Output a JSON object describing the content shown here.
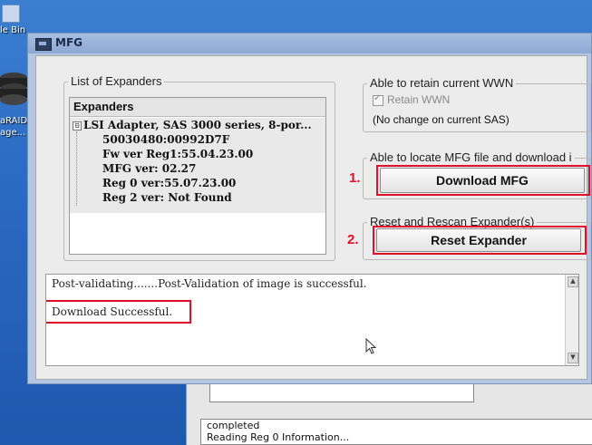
{
  "desktop": {
    "recycle_bin_label": "le Bin",
    "raid_label_line1": "aRAID",
    "raid_label_line2": "age..."
  },
  "window": {
    "title": "MFG"
  },
  "expanders_group": {
    "legend": "List of Expanders",
    "column_header": "Expanders",
    "root_item": "LSI Adapter, SAS 3000 series, 8-por...",
    "expander_glyph": "⊟",
    "children": [
      "50030480:00992D7F",
      "Fw ver Reg1:55.04.23.00",
      "MFG ver: 02.27",
      "Reg 0 ver:55.07.23.00",
      "Reg 2 ver: Not Found"
    ]
  },
  "wwn_group": {
    "legend": "Able to retain current WWN",
    "checkbox_label": "Retain WWN",
    "checkbox_checked": true,
    "note": "(No change on current SAS)"
  },
  "download_group": {
    "legend": "Able to locate MFG file and download i",
    "button_label": "Download MFG",
    "step_label": "1."
  },
  "reset_group": {
    "legend": "Reset and Rescan Expander(s)",
    "button_label": "Reset Expander",
    "step_label": "2."
  },
  "log": {
    "lines": [
      "Post-validating.......Post-Validation of image is successful.",
      "Download Successful."
    ]
  },
  "background_window": {
    "log_lines": [
      "completed",
      "Reading Reg 0 Information..."
    ]
  },
  "colors": {
    "annotation_red": "#e0102a",
    "desktop_blue": "#2b6bc2"
  }
}
